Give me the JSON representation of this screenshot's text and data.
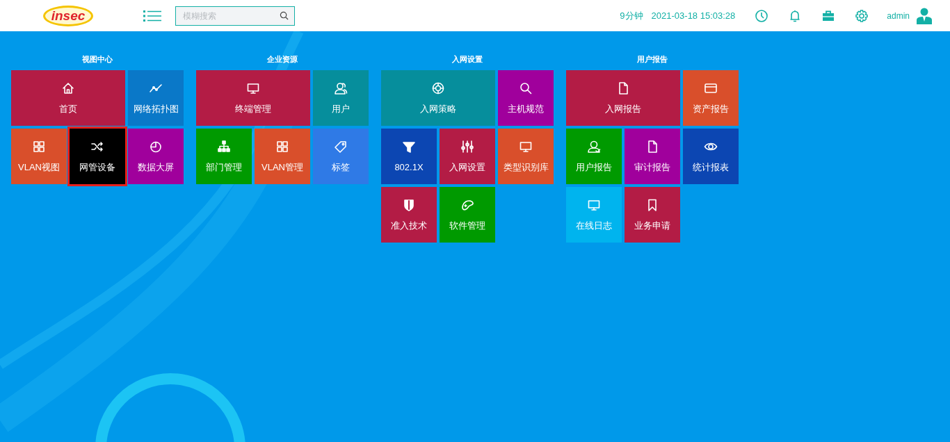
{
  "header": {
    "logo_text": "insec",
    "search": {
      "placeholder": "模糊搜索"
    },
    "session_time": "9分钟",
    "datetime": "2021-03-18 15:03:28",
    "username": "admin"
  },
  "groups": [
    {
      "title": "视图中心",
      "tiles": [
        {
          "label": "首页",
          "kind": "home",
          "color": "#b31c45",
          "wide": true,
          "selected": false
        },
        {
          "label": "网络拓扑图",
          "kind": "trend",
          "color": "#0a78c8",
          "wide": false,
          "selected": false
        },
        {
          "label": "VLAN视图",
          "kind": "grid",
          "color": "#d94f2b",
          "wide": false,
          "selected": false
        },
        {
          "label": "网管设备",
          "kind": "shuffle",
          "color": "#000000",
          "wide": false,
          "selected": true
        },
        {
          "label": "数据大屏",
          "kind": "pie",
          "color": "#a0009c",
          "wide": false,
          "selected": false
        }
      ]
    },
    {
      "title": "企业资源",
      "tiles": [
        {
          "label": "终端管理",
          "kind": "monitor",
          "color": "#b31c45",
          "wide": true,
          "selected": false
        },
        {
          "label": "用户",
          "kind": "users",
          "color": "#068e9c",
          "wide": false,
          "selected": false
        },
        {
          "label": "部门管理",
          "kind": "sitemap",
          "color": "#009a00",
          "wide": false,
          "selected": false
        },
        {
          "label": "VLAN管理",
          "kind": "grid",
          "color": "#d94f2b",
          "wide": false,
          "selected": false
        },
        {
          "label": "标签",
          "kind": "tag",
          "color": "#2f7ae6",
          "wide": false,
          "selected": false
        }
      ]
    },
    {
      "title": "入网设置",
      "tiles": [
        {
          "label": "入网策略",
          "kind": "lifebuoy",
          "color": "#068e9c",
          "wide": true,
          "selected": false
        },
        {
          "label": "主机规范",
          "kind": "search",
          "color": "#a0009c",
          "wide": false,
          "selected": false
        },
        {
          "label": "802.1X",
          "kind": "filter",
          "color": "#0c46b2",
          "wide": false,
          "selected": false
        },
        {
          "label": "入网设置",
          "kind": "sliders",
          "color": "#b31c45",
          "wide": false,
          "selected": false
        },
        {
          "label": "类型识别库",
          "kind": "monitor",
          "color": "#d94f2b",
          "wide": false,
          "selected": false
        },
        {
          "label": "准入技术",
          "kind": "shield",
          "color": "#b31c45",
          "wide": false,
          "selected": false
        },
        {
          "label": "软件管理",
          "kind": "gamepad",
          "color": "#009a00",
          "wide": false,
          "selected": false
        }
      ]
    },
    {
      "title": "用户报告",
      "tiles": [
        {
          "label": "入网报告",
          "kind": "file",
          "color": "#b31c45",
          "wide": true,
          "selected": false
        },
        {
          "label": "资产报告",
          "kind": "card",
          "color": "#d94f2b",
          "wide": false,
          "selected": false
        },
        {
          "label": "用户报告",
          "kind": "user",
          "color": "#009a00",
          "wide": false,
          "selected": false
        },
        {
          "label": "审计报告",
          "kind": "file",
          "color": "#a0009c",
          "wide": false,
          "selected": false
        },
        {
          "label": "统计报表",
          "kind": "eye",
          "color": "#0c46b2",
          "wide": false,
          "selected": false
        },
        {
          "label": "在线日志",
          "kind": "monitor",
          "color": "#00b4ee",
          "wide": false,
          "selected": false
        },
        {
          "label": "业务申请",
          "kind": "bookmark",
          "color": "#b31c45",
          "wide": false,
          "selected": false
        }
      ]
    }
  ]
}
